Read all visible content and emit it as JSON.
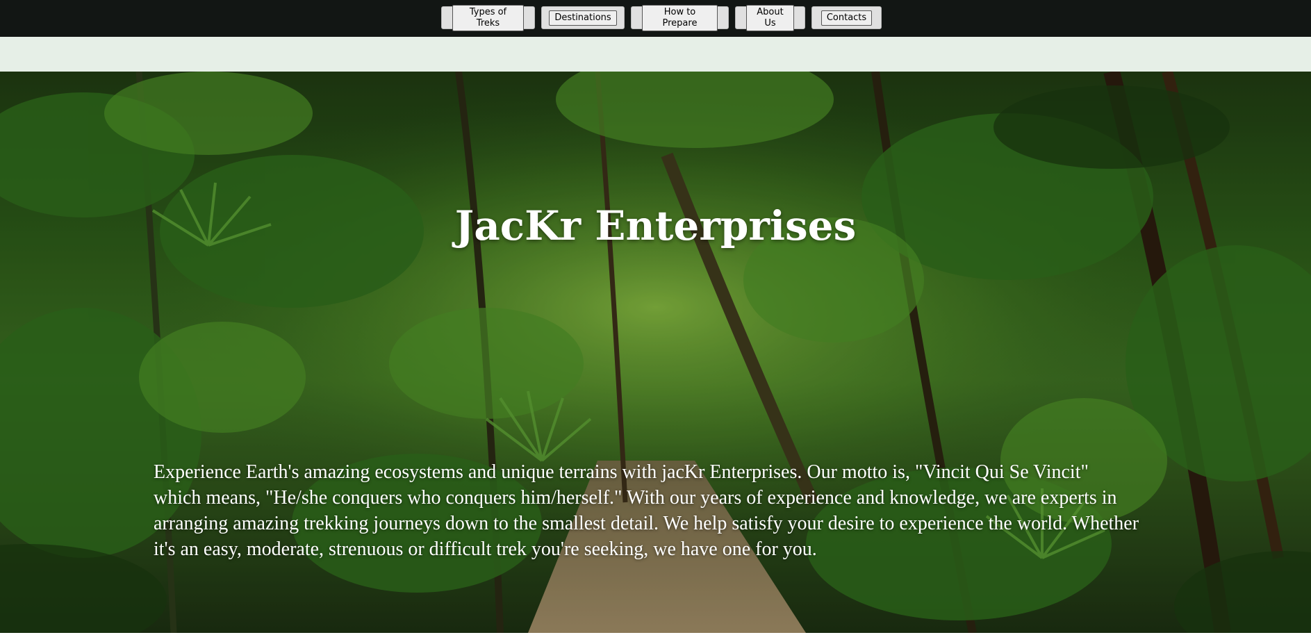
{
  "nav": {
    "items": [
      {
        "label": "Types of Treks"
      },
      {
        "label": "Destinations"
      },
      {
        "label": "How to Prepare"
      },
      {
        "label": "About Us"
      },
      {
        "label": "Contacts"
      }
    ]
  },
  "hero": {
    "title": "JacKr Enterprises",
    "description": "Experience Earth's amazing ecosystems and unique terrains with jacKr Enterprises. Our motto is, \"Vincit Qui Se Vincit\" which means, \"He/she conquers who conquers him/herself.\" With our years of experience and knowledge, we are experts in arranging amazing trekking journeys down to the smallest detail. We help satisfy your desire to experience the world. Whether it's an easy, moderate, strenuous or difficult trek you're seeking, we have one for you.",
    "image": "jungle-trail-background"
  },
  "colors": {
    "topbar": "#121614",
    "subbar": "#e6efe7",
    "title_text": "#ffffff"
  }
}
